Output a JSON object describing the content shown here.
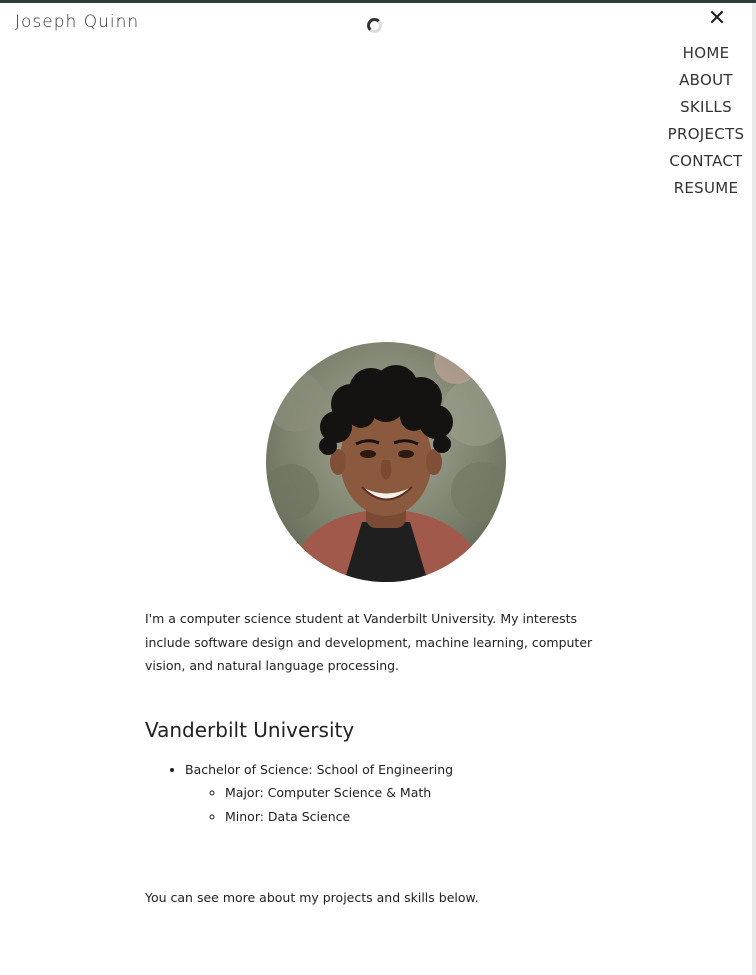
{
  "header": {
    "brand": "Joseph Quinn",
    "close_icon": "close-icon",
    "loading_icon": "spinner-icon"
  },
  "nav": {
    "items": [
      {
        "label": "HOME"
      },
      {
        "label": "ABOUT"
      },
      {
        "label": "SKILLS"
      },
      {
        "label": "PROJECTS"
      },
      {
        "label": "CONTACT"
      },
      {
        "label": "RESUME"
      }
    ]
  },
  "about": {
    "intro": "I'm a computer science student at Vanderbilt University. My interests include software design and development, machine learning, computer vision, and natural language processing.",
    "school": "Vanderbilt University",
    "degree": "Bachelor of Science: School of Engineering",
    "major": "Major: Computer Science & Math",
    "minor": "Minor: Data Science",
    "outro": "You can see more about my projects and skills below."
  },
  "colors": {
    "topbar": "#2d3a3a",
    "text": "#222222",
    "background": "#ffffff"
  }
}
